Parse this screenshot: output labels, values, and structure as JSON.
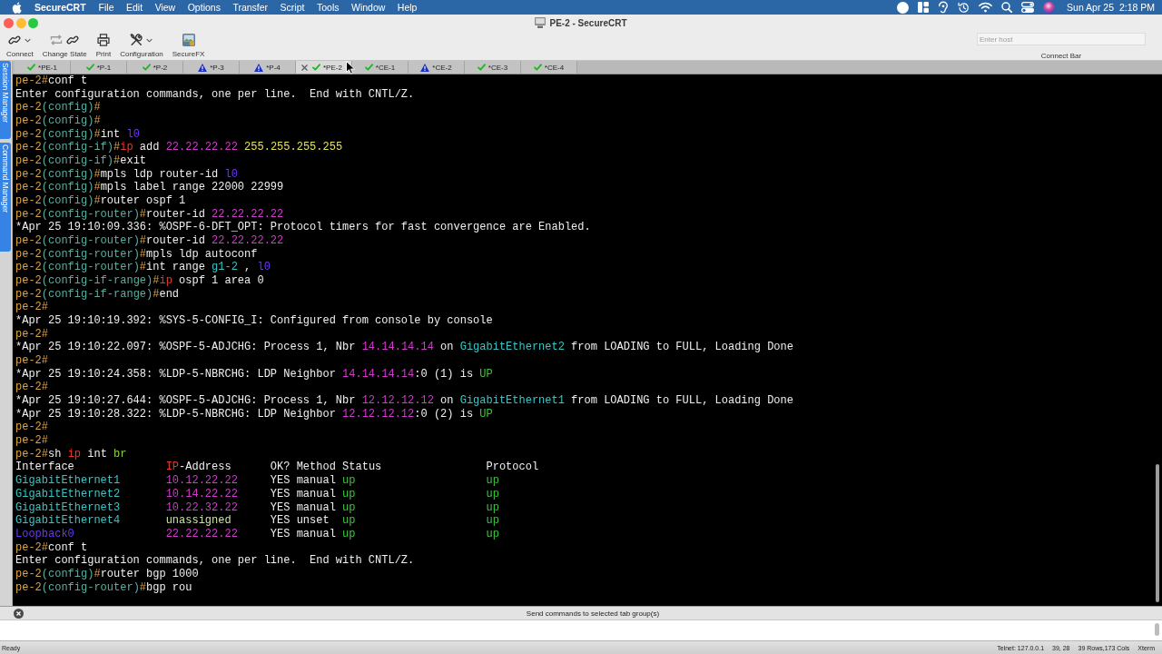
{
  "menu_bar": {
    "app_name": "SecureCRT",
    "menus": [
      "File",
      "Edit",
      "View",
      "Options",
      "Transfer",
      "Script",
      "Tools",
      "Window",
      "Help"
    ],
    "clock": "Sun Apr 25  2:18 PM"
  },
  "window": {
    "title": "PE-2 - SecureCRT"
  },
  "toolbar": {
    "buttons": [
      {
        "kind": "connect",
        "label": "Connect"
      },
      {
        "kind": "change_state",
        "label": "Change State"
      },
      {
        "kind": "print",
        "label": "Print"
      },
      {
        "kind": "configuration",
        "label": "Configuration"
      },
      {
        "kind": "securefx",
        "label": "SecureFX"
      }
    ],
    "host_field": {
      "placeholder": "Enter host"
    },
    "host_label": "Connect Bar"
  },
  "side_tabs": [
    "Session Manager",
    "Command Manager"
  ],
  "tabs": [
    {
      "label": "*PE-1",
      "warning": false,
      "selected": false
    },
    {
      "label": "*P-1",
      "warning": false,
      "selected": false
    },
    {
      "label": "*P-2",
      "warning": false,
      "selected": false
    },
    {
      "label": "*P-3",
      "warning": true,
      "selected": false
    },
    {
      "label": "*P-4",
      "warning": true,
      "selected": false
    },
    {
      "label": "*PE-2",
      "warning": false,
      "selected": true
    },
    {
      "label": "*CE-1",
      "warning": false,
      "selected": false
    },
    {
      "label": "*CE-2",
      "warning": true,
      "selected": false
    },
    {
      "label": "*CE-3",
      "warning": false,
      "selected": false
    },
    {
      "label": "*CE-4",
      "warning": false,
      "selected": false
    }
  ],
  "terminal": {
    "lines": [
      [
        {
          "kind": "prompt",
          "text": "pe-2#"
        },
        {
          "kind": "plain",
          "text": "conf t"
        }
      ],
      [
        {
          "kind": "plain",
          "text": "Enter configuration commands, one per line.  End with CNTL/Z."
        }
      ],
      [
        {
          "kind": "prompt",
          "text": "pe-2"
        },
        {
          "kind": "mode",
          "text": "(config)"
        },
        {
          "kind": "prompt",
          "text": "#"
        }
      ],
      [
        {
          "kind": "prompt",
          "text": "pe-2"
        },
        {
          "kind": "mode",
          "text": "(config)"
        },
        {
          "kind": "prompt",
          "text": "#"
        }
      ],
      [
        {
          "kind": "prompt",
          "text": "pe-2"
        },
        {
          "kind": "mode",
          "text": "(config)"
        },
        {
          "kind": "prompt",
          "text": "#"
        },
        {
          "kind": "plain",
          "text": "int "
        },
        {
          "kind": "loopback",
          "text": "l0"
        }
      ],
      [
        {
          "kind": "prompt",
          "text": "pe-2"
        },
        {
          "kind": "mode",
          "text": "(config-if)"
        },
        {
          "kind": "prompt",
          "text": "#"
        },
        {
          "kind": "keyword",
          "text": "ip"
        },
        {
          "kind": "plain",
          "text": " add "
        },
        {
          "kind": "address",
          "text": "22.22.22.22 "
        },
        {
          "kind": "mask",
          "text": "255.255.255.255"
        }
      ],
      [
        {
          "kind": "prompt",
          "text": "pe-2"
        },
        {
          "kind": "mode",
          "text": "(config-if)"
        },
        {
          "kind": "prompt",
          "text": "#"
        },
        {
          "kind": "plain",
          "text": "exit"
        }
      ],
      [
        {
          "kind": "prompt",
          "text": "pe-2"
        },
        {
          "kind": "mode",
          "text": "(config)"
        },
        {
          "kind": "prompt",
          "text": "#"
        },
        {
          "kind": "plain",
          "text": "mpls ldp router-id "
        },
        {
          "kind": "loopback",
          "text": "l0"
        }
      ],
      [
        {
          "kind": "prompt",
          "text": "pe-2"
        },
        {
          "kind": "mode",
          "text": "(config)"
        },
        {
          "kind": "prompt",
          "text": "#"
        },
        {
          "kind": "plain",
          "text": "mpls label range 22000 22999"
        }
      ],
      [
        {
          "kind": "prompt",
          "text": "pe-2"
        },
        {
          "kind": "mode",
          "text": "(config)"
        },
        {
          "kind": "prompt",
          "text": "#"
        },
        {
          "kind": "plain",
          "text": "router ospf 1"
        }
      ],
      [
        {
          "kind": "prompt",
          "text": "pe-2"
        },
        {
          "kind": "mode",
          "text": "(config-router)"
        },
        {
          "kind": "prompt",
          "text": "#"
        },
        {
          "kind": "plain",
          "text": "router-id "
        },
        {
          "kind": "address",
          "text": "22.22.22.22"
        }
      ],
      [
        {
          "kind": "plain",
          "text": "*Apr 25 19:10:09.336: %OSPF-6-DFT_OPT: Protocol timers for fast convergence are Enabled."
        }
      ],
      [
        {
          "kind": "prompt",
          "text": "pe-2"
        },
        {
          "kind": "mode",
          "text": "(config-router)"
        },
        {
          "kind": "prompt",
          "text": "#"
        },
        {
          "kind": "plain",
          "text": "router-id "
        },
        {
          "kind": "address",
          "text": "22.22.22.22"
        }
      ],
      [
        {
          "kind": "prompt",
          "text": "pe-2"
        },
        {
          "kind": "mode",
          "text": "(config-router)"
        },
        {
          "kind": "prompt",
          "text": "#"
        },
        {
          "kind": "plain",
          "text": "mpls ldp autoconf"
        }
      ],
      [
        {
          "kind": "prompt",
          "text": "pe-2"
        },
        {
          "kind": "mode",
          "text": "(config-router)"
        },
        {
          "kind": "prompt",
          "text": "#"
        },
        {
          "kind": "plain",
          "text": "int range "
        },
        {
          "kind": "interface",
          "text": "g1-2"
        },
        {
          "kind": "plain",
          "text": " , "
        },
        {
          "kind": "loopback",
          "text": "l0"
        }
      ],
      [
        {
          "kind": "prompt",
          "text": "pe-2"
        },
        {
          "kind": "mode",
          "text": "(config-if-range)"
        },
        {
          "kind": "prompt",
          "text": "#"
        },
        {
          "kind": "keyword",
          "text": "ip"
        },
        {
          "kind": "plain",
          "text": " ospf 1 area 0"
        }
      ],
      [
        {
          "kind": "prompt",
          "text": "pe-2"
        },
        {
          "kind": "mode",
          "text": "(config-if-range)"
        },
        {
          "kind": "prompt",
          "text": "#"
        },
        {
          "kind": "plain",
          "text": "end"
        }
      ],
      [
        {
          "kind": "prompt",
          "text": "pe-2#"
        }
      ],
      [
        {
          "kind": "plain",
          "text": "*Apr 25 19:10:19.392: %SYS-5-CONFIG_I: Configured from console by console"
        }
      ],
      [
        {
          "kind": "prompt",
          "text": "pe-2#"
        }
      ],
      [
        {
          "kind": "plain",
          "text": "*Apr 25 19:10:22.097: %OSPF-5-ADJCHG: Process 1, Nbr "
        },
        {
          "kind": "address",
          "text": "14.14.14.14"
        },
        {
          "kind": "plain",
          "text": " on "
        },
        {
          "kind": "interface",
          "text": "GigabitEthernet2"
        },
        {
          "kind": "plain",
          "text": " from LOADING to FULL, Loading Done"
        }
      ],
      [
        {
          "kind": "prompt",
          "text": "pe-2#"
        }
      ],
      [
        {
          "kind": "plain",
          "text": "*Apr 25 19:10:24.358: %LDP-5-NBRCHG: LDP Neighbor "
        },
        {
          "kind": "address",
          "text": "14.14.14.14"
        },
        {
          "kind": "plain",
          "text": ":0 (1) is "
        },
        {
          "kind": "state",
          "text": "UP"
        }
      ],
      [
        {
          "kind": "prompt",
          "text": "pe-2#"
        }
      ],
      [
        {
          "kind": "plain",
          "text": "*Apr 25 19:10:27.644: %OSPF-5-ADJCHG: Process 1, Nbr "
        },
        {
          "kind": "address",
          "text": "12.12.12.12"
        },
        {
          "kind": "plain",
          "text": " on "
        },
        {
          "kind": "interface",
          "text": "GigabitEthernet1"
        },
        {
          "kind": "plain",
          "text": " from LOADING to FULL, Loading Done"
        }
      ],
      [
        {
          "kind": "plain",
          "text": "*Apr 25 19:10:28.322: %LDP-5-NBRCHG: LDP Neighbor "
        },
        {
          "kind": "address",
          "text": "12.12.12.12"
        },
        {
          "kind": "plain",
          "text": ":0 (2) is "
        },
        {
          "kind": "state",
          "text": "UP"
        }
      ],
      [
        {
          "kind": "prompt",
          "text": "pe-2#"
        }
      ],
      [
        {
          "kind": "prompt",
          "text": "pe-2#"
        }
      ],
      [
        {
          "kind": "prompt",
          "text": "pe-2#"
        },
        {
          "kind": "plain",
          "text": "sh "
        },
        {
          "kind": "keyword",
          "text": "ip"
        },
        {
          "kind": "plain",
          "text": " int "
        },
        {
          "kind": "option",
          "text": "br"
        }
      ],
      [
        {
          "kind": "plain",
          "text": "Interface              "
        },
        {
          "kind": "keyword",
          "text": "IP"
        },
        {
          "kind": "plain",
          "text": "-Address      OK? Method Status                Protocol"
        }
      ],
      [
        {
          "kind": "interface",
          "text": "GigabitEthernet1       "
        },
        {
          "kind": "address",
          "text": "10.12.22.22"
        },
        {
          "kind": "plain",
          "text": "     YES manual "
        },
        {
          "kind": "state",
          "text": "up                    "
        },
        {
          "kind": "state",
          "text": "up"
        }
      ],
      [
        {
          "kind": "interface",
          "text": "GigabitEthernet2       "
        },
        {
          "kind": "address",
          "text": "10.14.22.22"
        },
        {
          "kind": "plain",
          "text": "     YES manual "
        },
        {
          "kind": "state",
          "text": "up                    "
        },
        {
          "kind": "state",
          "text": "up"
        }
      ],
      [
        {
          "kind": "interface",
          "text": "GigabitEthernet3       "
        },
        {
          "kind": "address",
          "text": "10.22.32.22"
        },
        {
          "kind": "plain",
          "text": "     YES manual "
        },
        {
          "kind": "state",
          "text": "up                    "
        },
        {
          "kind": "state",
          "text": "up"
        }
      ],
      [
        {
          "kind": "interface",
          "text": "GigabitEthernet4       "
        },
        {
          "kind": "unassigned",
          "text": "unassigned"
        },
        {
          "kind": "plain",
          "text": "      YES unset  "
        },
        {
          "kind": "state",
          "text": "up                    "
        },
        {
          "kind": "state",
          "text": "up"
        }
      ],
      [
        {
          "kind": "loopback",
          "text": "Loopback0              "
        },
        {
          "kind": "address",
          "text": "22.22.22.22"
        },
        {
          "kind": "plain",
          "text": "     YES manual "
        },
        {
          "kind": "state",
          "text": "up                    "
        },
        {
          "kind": "state",
          "text": "up"
        }
      ],
      [
        {
          "kind": "prompt",
          "text": "pe-2#"
        },
        {
          "kind": "plain",
          "text": "conf t"
        }
      ],
      [
        {
          "kind": "plain",
          "text": "Enter configuration commands, one per line.  End with CNTL/Z."
        }
      ],
      [
        {
          "kind": "prompt",
          "text": "pe-2"
        },
        {
          "kind": "mode",
          "text": "(config)"
        },
        {
          "kind": "prompt",
          "text": "#"
        },
        {
          "kind": "plain",
          "text": "router bgp 1000"
        }
      ],
      [
        {
          "kind": "prompt",
          "text": "pe-2"
        },
        {
          "kind": "mode",
          "text": "(config-router)"
        },
        {
          "kind": "prompt",
          "text": "#"
        },
        {
          "kind": "plain",
          "text": "bgp rou"
        }
      ]
    ]
  },
  "command_window": {
    "caption": "Send commands to selected tab group(s)"
  },
  "status_bar": {
    "message": "Ready",
    "connection": "Telnet: 127.0.0.1",
    "cursor": "39, 28",
    "size": "39 Rows,173 Cols",
    "emulation": "Xterm"
  }
}
